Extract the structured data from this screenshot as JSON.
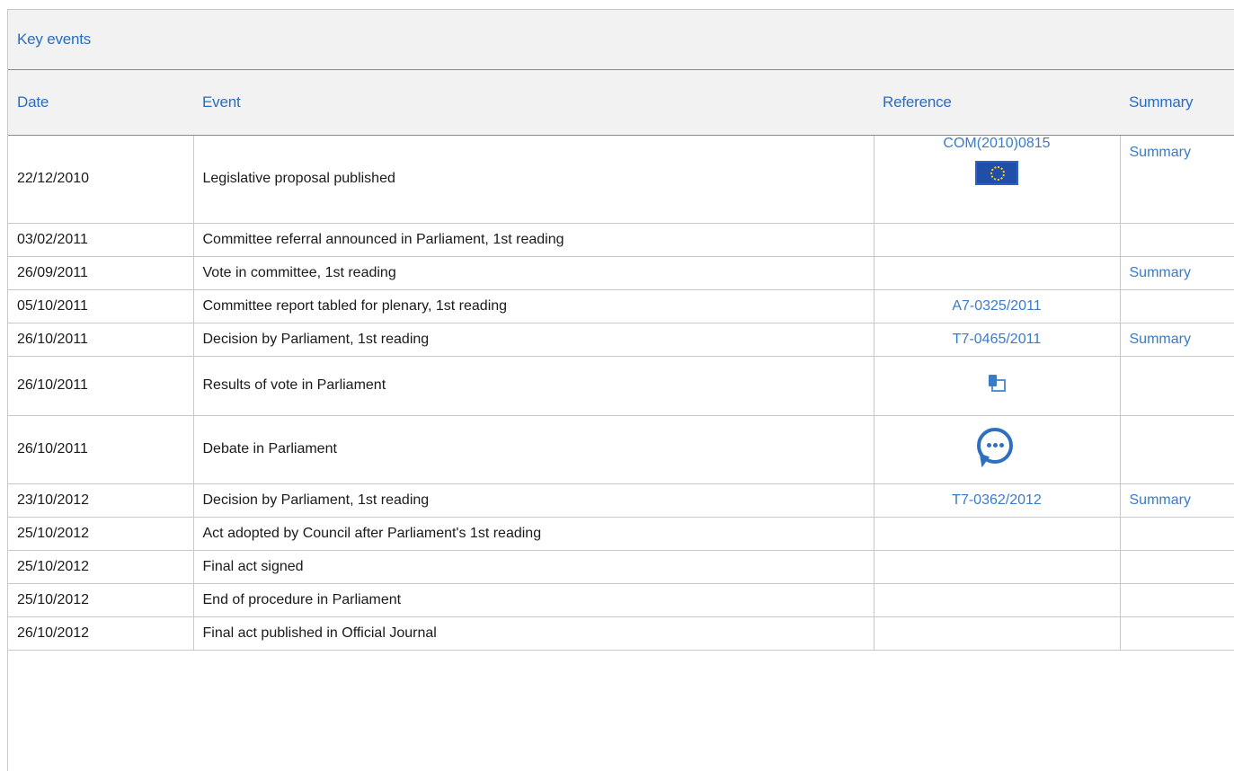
{
  "panel": {
    "title": "Key events"
  },
  "columns": {
    "date": "Date",
    "event": "Event",
    "reference": "Reference",
    "summary": "Summary"
  },
  "rows": [
    {
      "date": "22/12/2010",
      "event": "Legislative proposal published",
      "reference": "COM(2010)0815",
      "reference_icon": "eu-flag-icon",
      "summary": "Summary"
    },
    {
      "date": "03/02/2011",
      "event": "Committee referral announced in Parliament, 1st reading",
      "reference": "",
      "summary": ""
    },
    {
      "date": "26/09/2011",
      "event": "Vote in committee, 1st reading",
      "reference": "",
      "summary": "Summary"
    },
    {
      "date": "05/10/2011",
      "event": "Committee report tabled for plenary, 1st reading",
      "reference": "A7-0325/2011",
      "summary": ""
    },
    {
      "date": "26/10/2011",
      "event": "Decision by Parliament, 1st reading",
      "reference": "T7-0465/2011",
      "summary": "Summary"
    },
    {
      "date": "26/10/2011",
      "event": "Results of vote in Parliament",
      "reference": "",
      "reference_icon": "vote-results-icon",
      "summary": ""
    },
    {
      "date": "26/10/2011",
      "event": "Debate in Parliament",
      "reference": "",
      "reference_icon": "debate-chat-icon",
      "summary": ""
    },
    {
      "date": "23/10/2012",
      "event": "Decision by Parliament, 1st reading",
      "reference": "T7-0362/2012",
      "summary": "Summary"
    },
    {
      "date": "25/10/2012",
      "event": "Act adopted by Council after Parliament's 1st reading",
      "reference": "",
      "summary": ""
    },
    {
      "date": "25/10/2012",
      "event": "Final act signed",
      "reference": "",
      "summary": ""
    },
    {
      "date": "25/10/2012",
      "event": "End of procedure in Parliament",
      "reference": "",
      "summary": ""
    },
    {
      "date": "26/10/2012",
      "event": "Final act published in Official Journal",
      "reference": "",
      "summary": ""
    }
  ],
  "colors": {
    "link": "#3a7bc8",
    "header_text": "#2a6cbf",
    "header_bg": "#f2f2f2",
    "border": "#c8c8c8"
  }
}
